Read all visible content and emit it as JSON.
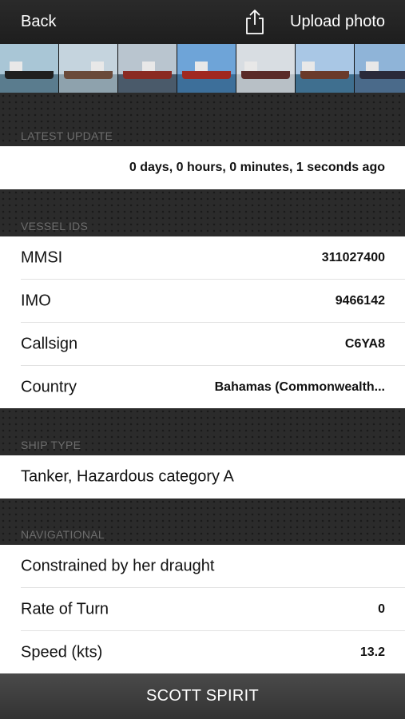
{
  "nav": {
    "back_label": "Back",
    "share_icon": "share-icon",
    "upload_label": "Upload photo"
  },
  "photos": [
    {
      "sky": "#a9c6d6",
      "sea": "#5a7c8e",
      "hull": "#1f1f1f"
    },
    {
      "sky": "#c5d4de",
      "sea": "#8ea2ad",
      "hull": "#6a4a3a"
    },
    {
      "sky": "#b9c5cf",
      "sea": "#4a5a6a",
      "hull": "#8a2a22"
    },
    {
      "sky": "#6ea4d8",
      "sea": "#3d6f9a",
      "hull": "#a02820"
    },
    {
      "sky": "#d8dde2",
      "sea": "#b8c0c6",
      "hull": "#5a2a28"
    },
    {
      "sky": "#a9c7e5",
      "sea": "#3f6f8f",
      "hull": "#6a3a2a"
    },
    {
      "sky": "#8fb4d8",
      "sea": "#4a6a8a",
      "hull": "#2a2a3a"
    }
  ],
  "latest_update": {
    "section_label": "LATEST UPDATE",
    "value": "0 days, 0 hours, 0 minutes, 1 seconds ago"
  },
  "vessel_ids": {
    "section_label": "VESSEL IDS",
    "rows": [
      {
        "label": "MMSI",
        "value": "311027400"
      },
      {
        "label": "IMO",
        "value": "9466142"
      },
      {
        "label": "Callsign",
        "value": "C6YA8"
      },
      {
        "label": "Country",
        "value": "Bahamas (Commonwealth..."
      }
    ]
  },
  "ship_type": {
    "section_label": "SHIP TYPE",
    "value": "Tanker, Hazardous category A"
  },
  "navigational": {
    "section_label": "NAVIGATIONAL",
    "status": "Constrained by her draught",
    "rows": [
      {
        "label": "Rate of Turn",
        "value": "0"
      },
      {
        "label": "Speed (kts)",
        "value": "13.2"
      }
    ]
  },
  "footer": {
    "vessel_name": "SCOTT SPIRIT"
  }
}
